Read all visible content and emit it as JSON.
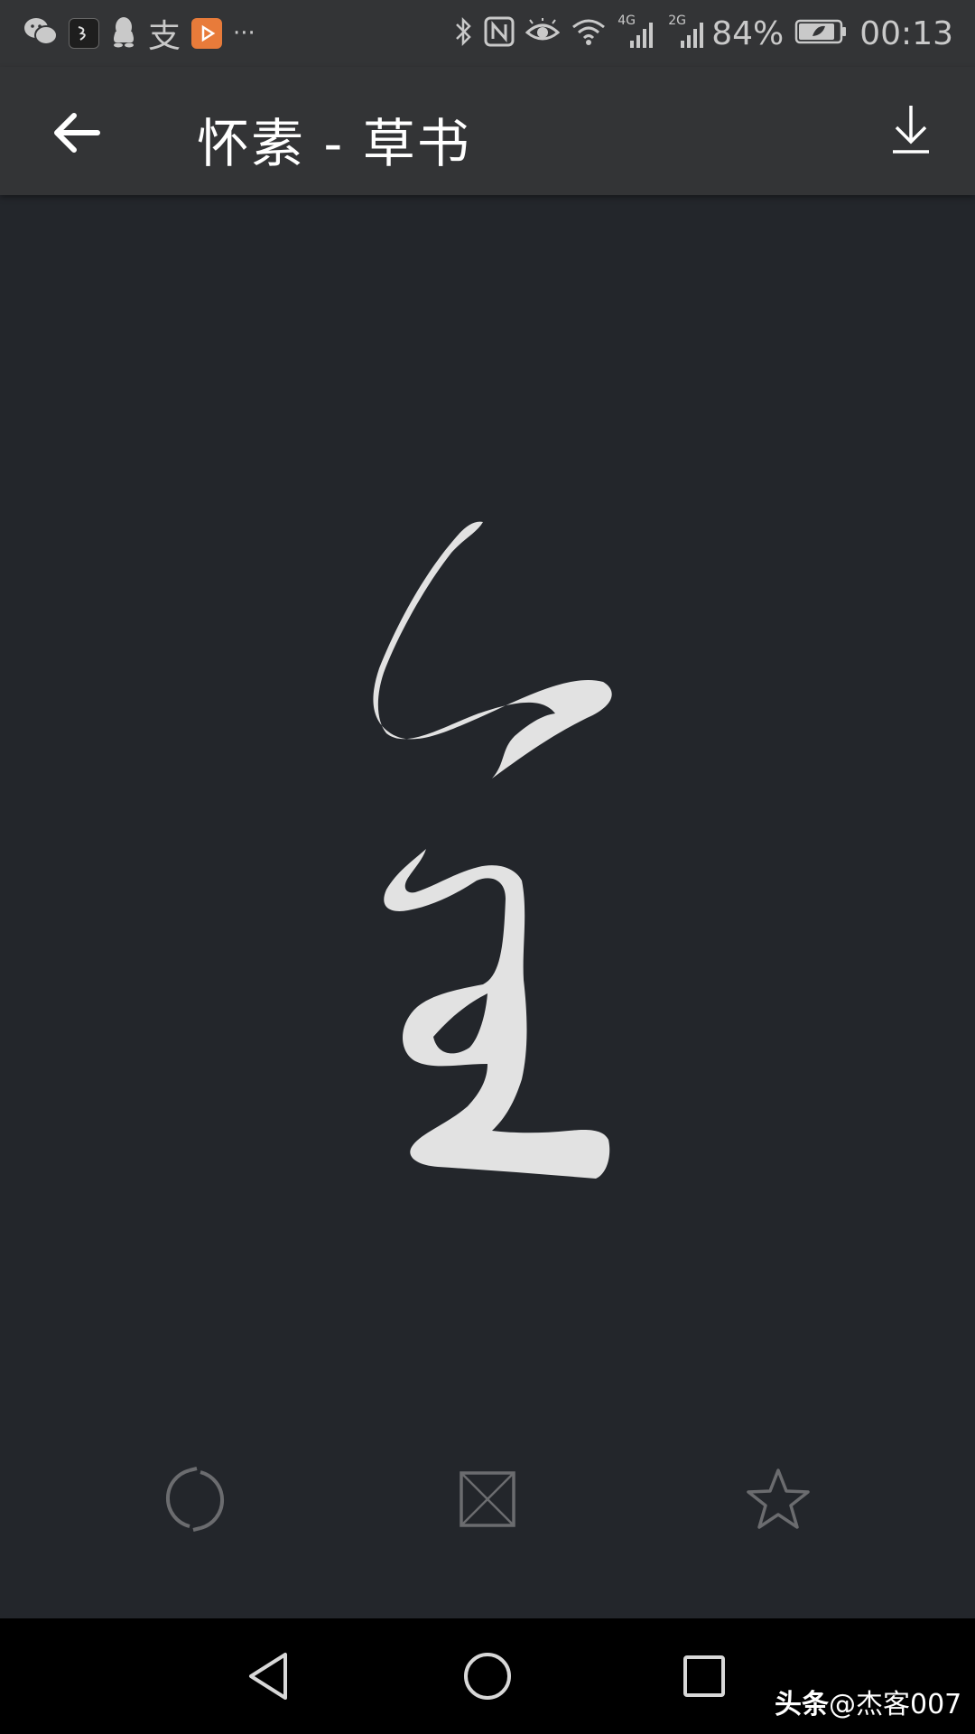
{
  "status_bar": {
    "notification_icons": [
      "wechat-icon",
      "app-icon",
      "qq-icon",
      "alipay-icon",
      "video-icon",
      "more-icon"
    ],
    "alipay_glyph": "支",
    "more_glyph": "···",
    "network_4g": "4G",
    "network_2g": "2G",
    "battery": "84%",
    "time": "00:13"
  },
  "app_bar": {
    "title": "怀素 - 草书"
  },
  "actions": [
    "refresh-icon",
    "grid-icon",
    "star-icon"
  ],
  "nav_bar": [
    "back-triangle-icon",
    "home-circle-icon",
    "recents-square-icon"
  ],
  "watermark": {
    "brand": "头条",
    "handle": "@杰客007"
  },
  "colors": {
    "background": "#23262b",
    "bar": "#333436",
    "ink": "#e2e2e2",
    "action_icon": "#6b6c6f"
  }
}
